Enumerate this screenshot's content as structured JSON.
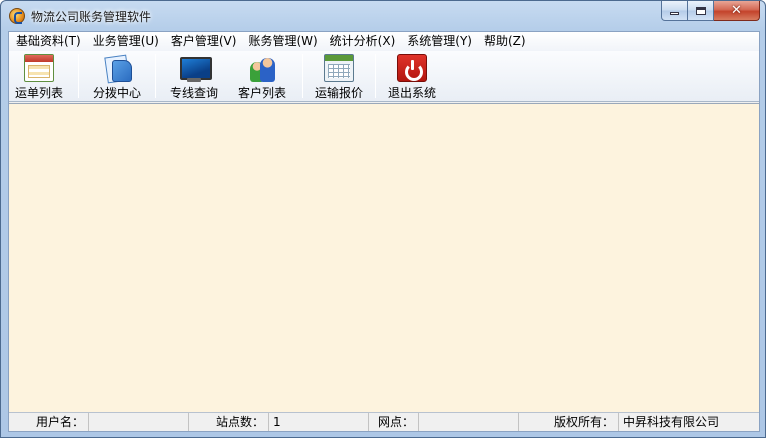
{
  "window": {
    "title": "物流公司账务管理软件"
  },
  "menu": {
    "items": [
      {
        "label": "基础资料(T)"
      },
      {
        "label": "业务管理(U)"
      },
      {
        "label": "客户管理(V)"
      },
      {
        "label": "账务管理(W)"
      },
      {
        "label": "统计分析(X)"
      },
      {
        "label": "系统管理(Y)"
      },
      {
        "label": "帮助(Z)"
      }
    ]
  },
  "toolbar": {
    "waybill_list": "运单列表",
    "distribution_center": "分拨中心",
    "line_query": "专线查询",
    "customer_list": "客户列表",
    "transport_quote": "运输报价",
    "exit_system": "退出系统"
  },
  "icons": {
    "waybill_list": "calendar-list-icon",
    "distribution_center": "documents-icon",
    "line_query": "monitor-icon",
    "customer_list": "people-icon",
    "transport_quote": "spreadsheet-icon",
    "exit_system": "power-icon"
  },
  "colors": {
    "content_background": "#fdf3de",
    "exit_red": "#c41e14"
  },
  "statusbar": {
    "user_label": "用户名：",
    "user_value": "",
    "station_label": "站点数：",
    "station_value": "1",
    "branch_label": "网点：",
    "branch_value": "",
    "copyright_label": "版权所有：",
    "copyright_value": "中昇科技有限公司"
  }
}
